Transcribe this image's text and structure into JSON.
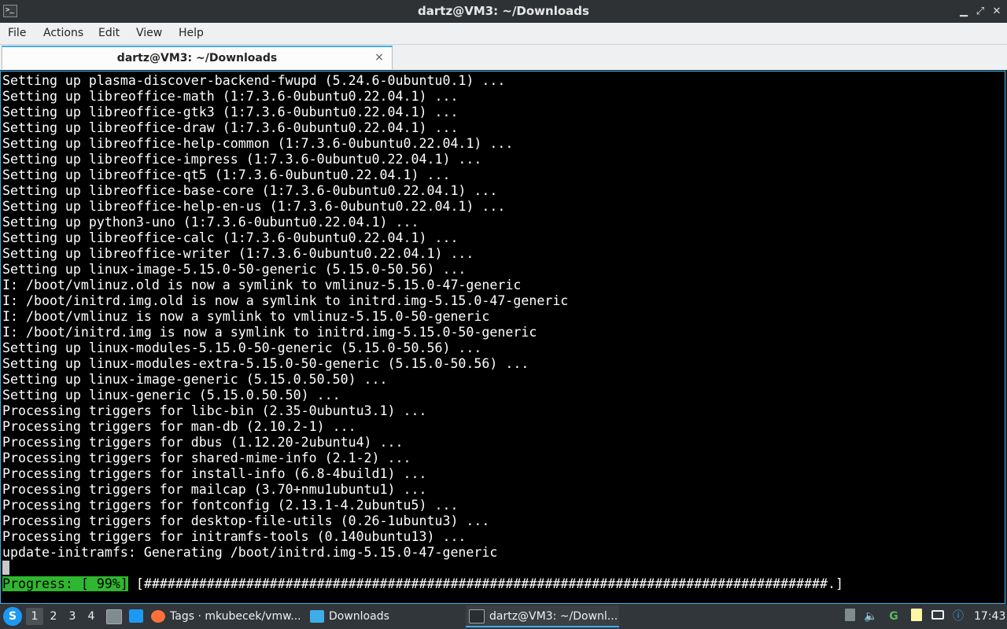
{
  "window": {
    "title": "dartz@VM3: ~/Downloads",
    "app_icon_text": ">_",
    "minimize": "▁",
    "maximize": "⤢",
    "close": "✕"
  },
  "menu": [
    "File",
    "Actions",
    "Edit",
    "View",
    "Help"
  ],
  "tab": {
    "label": "dartz@VM3: ~/Downloads",
    "close": "×"
  },
  "terminal": {
    "lines": [
      "Setting up plasma-discover-backend-fwupd (5.24.6-0ubuntu0.1) ...",
      "Setting up libreoffice-math (1:7.3.6-0ubuntu0.22.04.1) ...",
      "Setting up libreoffice-gtk3 (1:7.3.6-0ubuntu0.22.04.1) ...",
      "Setting up libreoffice-draw (1:7.3.6-0ubuntu0.22.04.1) ...",
      "Setting up libreoffice-help-common (1:7.3.6-0ubuntu0.22.04.1) ...",
      "Setting up libreoffice-impress (1:7.3.6-0ubuntu0.22.04.1) ...",
      "Setting up libreoffice-qt5 (1:7.3.6-0ubuntu0.22.04.1) ...",
      "Setting up libreoffice-base-core (1:7.3.6-0ubuntu0.22.04.1) ...",
      "Setting up libreoffice-help-en-us (1:7.3.6-0ubuntu0.22.04.1) ...",
      "Setting up python3-uno (1:7.3.6-0ubuntu0.22.04.1) ...",
      "Setting up libreoffice-calc (1:7.3.6-0ubuntu0.22.04.1) ...",
      "Setting up libreoffice-writer (1:7.3.6-0ubuntu0.22.04.1) ...",
      "Setting up linux-image-5.15.0-50-generic (5.15.0-50.56) ...",
      "I: /boot/vmlinuz.old is now a symlink to vmlinuz-5.15.0-47-generic",
      "I: /boot/initrd.img.old is now a symlink to initrd.img-5.15.0-47-generic",
      "I: /boot/vmlinuz is now a symlink to vmlinuz-5.15.0-50-generic",
      "I: /boot/initrd.img is now a symlink to initrd.img-5.15.0-50-generic",
      "Setting up linux-modules-5.15.0-50-generic (5.15.0-50.56) ...",
      "Setting up linux-modules-extra-5.15.0-50-generic (5.15.0-50.56) ...",
      "Setting up linux-image-generic (5.15.0.50.50) ...",
      "Setting up linux-generic (5.15.0.50.50) ...",
      "Processing triggers for libc-bin (2.35-0ubuntu3.1) ...",
      "Processing triggers for man-db (2.10.2-1) ...",
      "Processing triggers for dbus (1.12.20-2ubuntu4) ...",
      "Processing triggers for shared-mime-info (2.1-2) ...",
      "Processing triggers for install-info (6.8-4build1) ...",
      "Processing triggers for mailcap (3.70+nmu1ubuntu1) ...",
      "Processing triggers for fontconfig (2.13.1-4.2ubuntu5) ...",
      "Processing triggers for desktop-file-utils (0.26-1ubuntu3) ...",
      "Processing triggers for initramfs-tools (0.140ubuntu13) ...",
      "update-initramfs: Generating /boot/initrd.img-5.15.0-47-generic"
    ],
    "progress_label": "Progress: [ 99%]",
    "progress_bar": " [#######################################################################################.] ",
    "progress_percent": 99
  },
  "taskbar": {
    "start_icon": "S",
    "desktops": [
      "1",
      "2",
      "3",
      "4"
    ],
    "active_desktop": 1,
    "tasks": [
      {
        "label": "Tags · mkubecek/vmw...",
        "icon": "firefox-icon",
        "color": "#ff7139"
      },
      {
        "label": "Downloads",
        "icon": "folder-icon",
        "color": "#3daee9"
      },
      {
        "label": "dartz@VM3: ~/Downl...",
        "icon": "terminal-icon",
        "color": "#2a2e32"
      }
    ],
    "clock": "17:43",
    "colors": {
      "accent": "#3daee9",
      "progress_green": "#2fb72f"
    }
  }
}
